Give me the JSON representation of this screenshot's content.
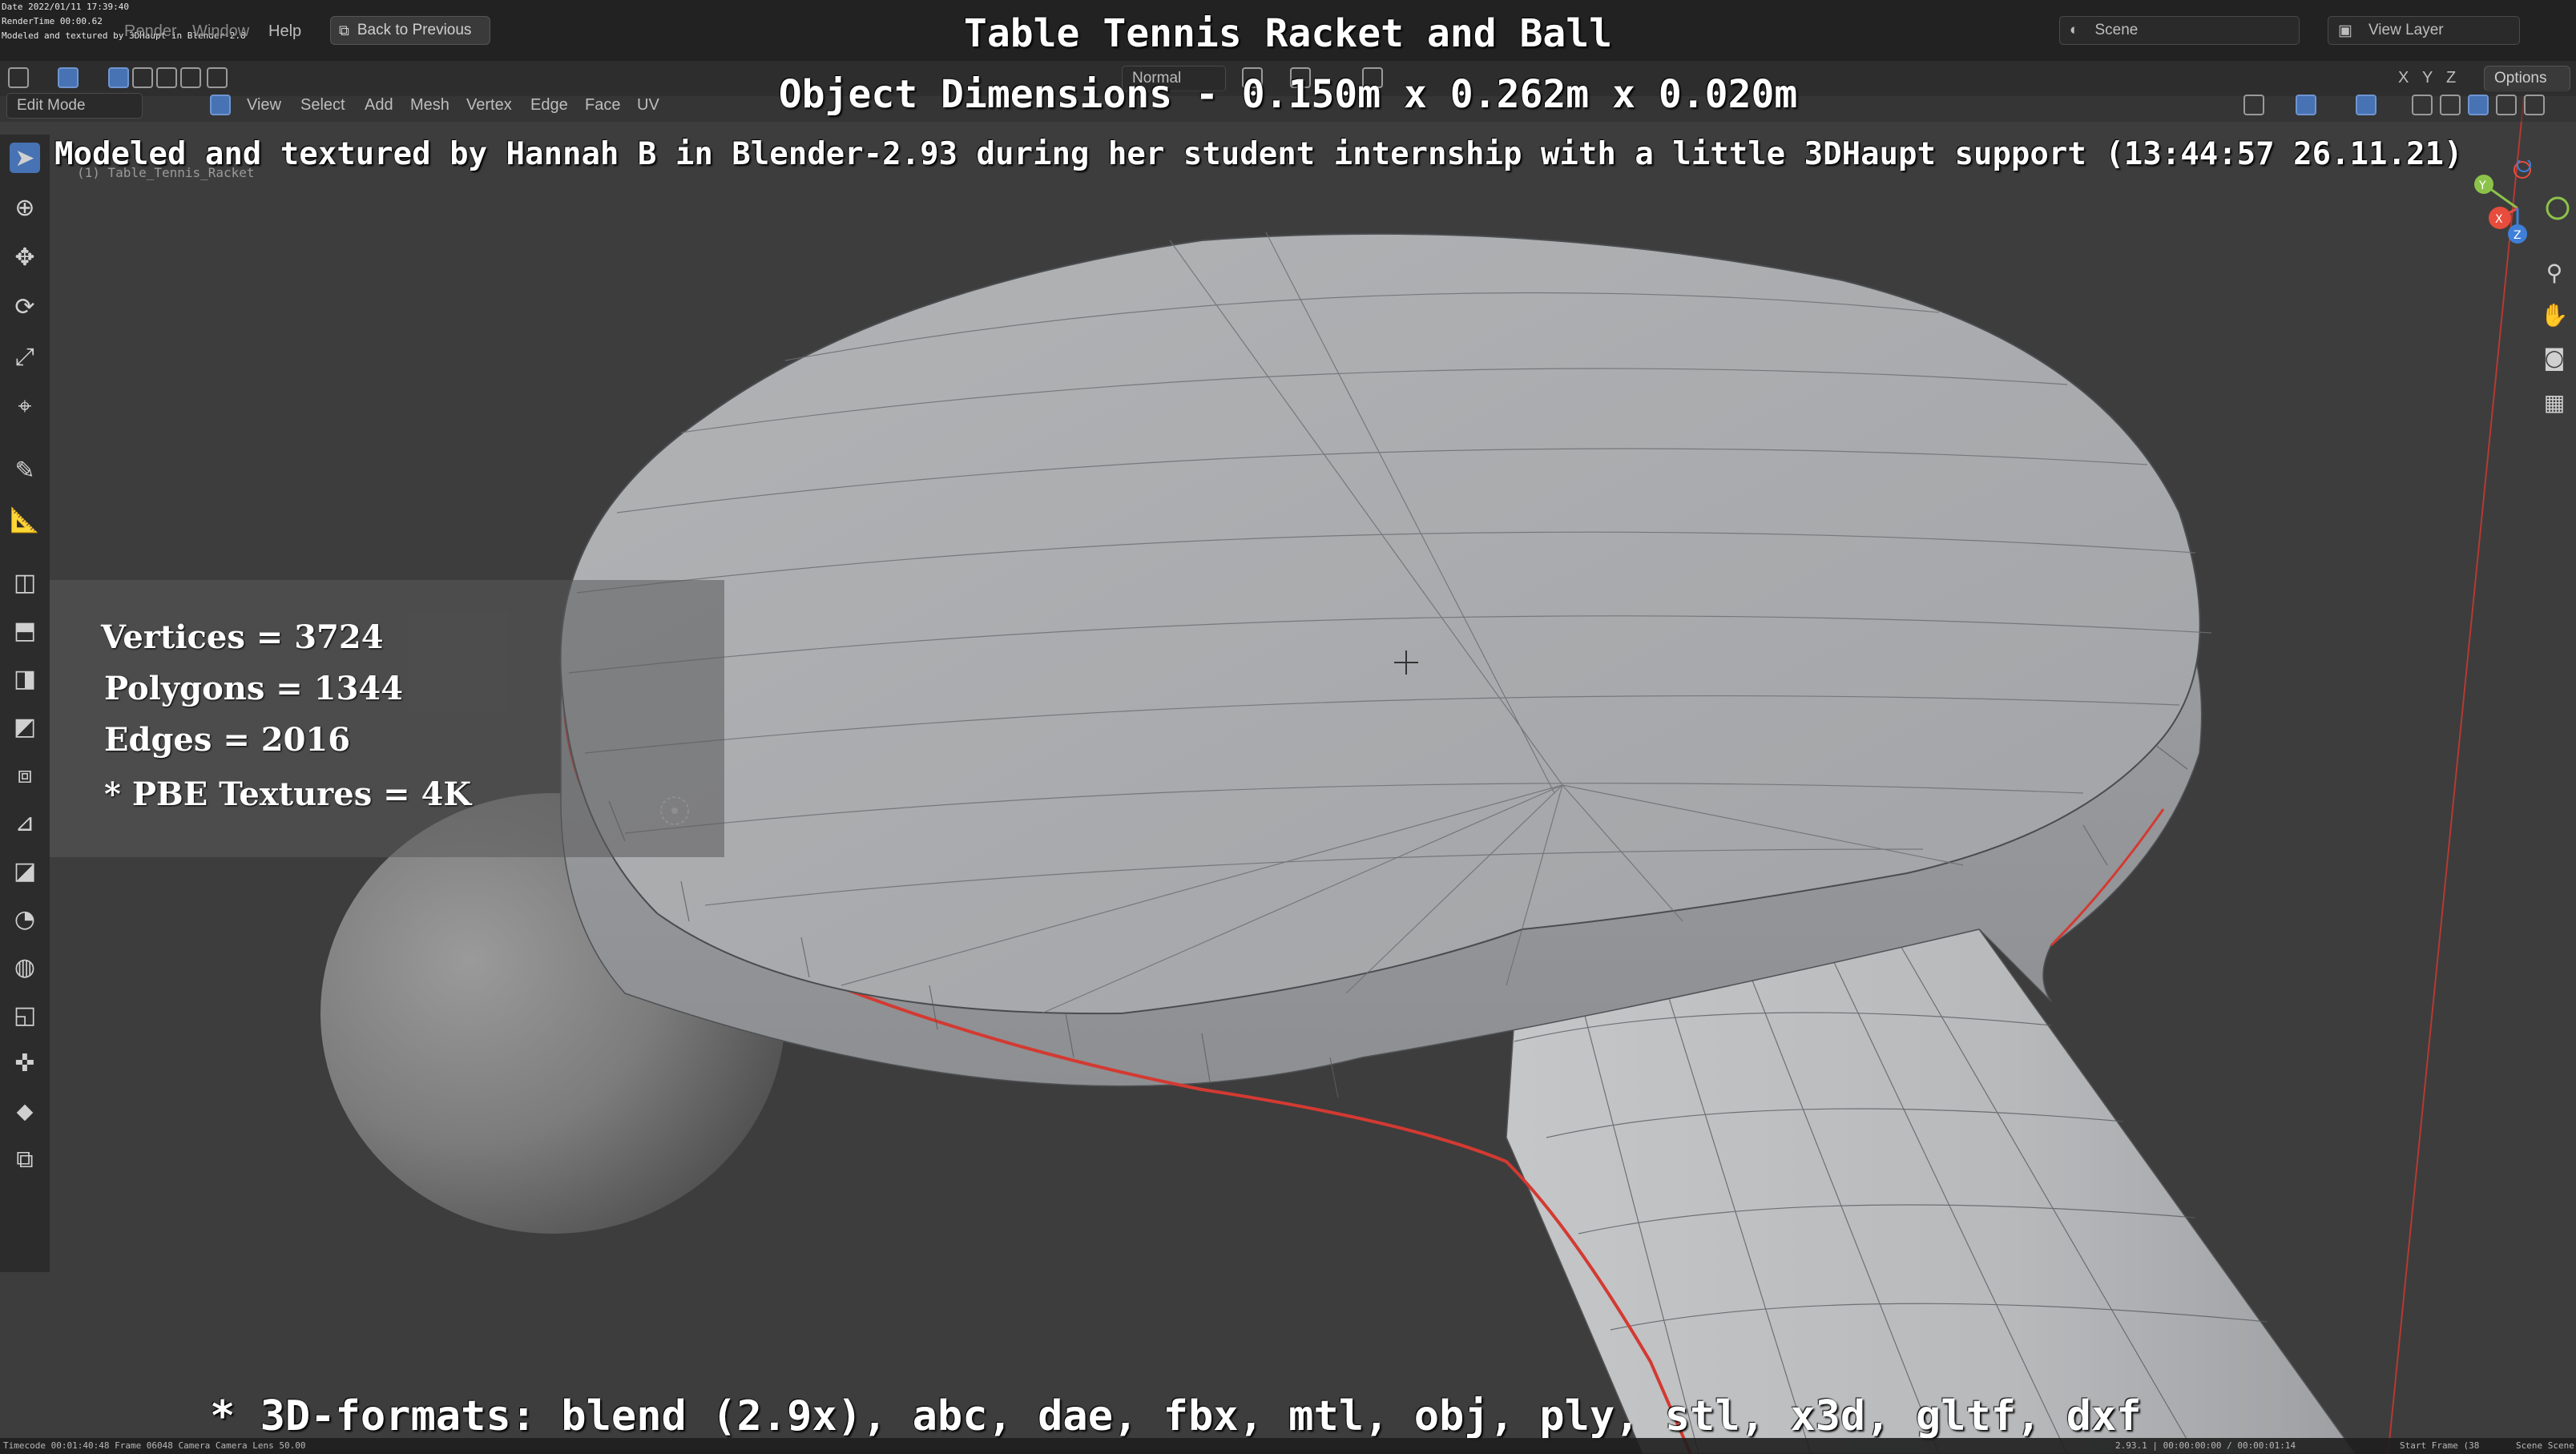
{
  "overlay": {
    "title": "Table Tennis Racket and Ball",
    "dimensions": "Object Dimensions -  0.150m x 0.262m x 0.020m",
    "credit": "Modeled and textured by Hannah B in Blender-2.93 during her student internship with a little 3DHaupt support (13:44:57 26.11.21)",
    "formats": "* 3D-formats: blend (2.9x), abc, dae, fbx, mtl, obj, ply, stl, x3d, gltf, dxf",
    "stats": {
      "vertices": "Vertices = 3724",
      "polygons": "Polygons = 1344",
      "edges": "Edges = 2016",
      "textures": "* PBE Textures = 4K"
    }
  },
  "stamp": {
    "date": "Date 2022/01/11 17:39:40",
    "rendertime": "RenderTime 00:00.62",
    "note": "Modeled and textured by 3DHaupt in Blender-2.8"
  },
  "topbar": {
    "menus": [
      "Render",
      "Window",
      "Help"
    ],
    "back_button": "Back to Previous",
    "scene_label": "Scene",
    "view_layer_label": "View Layer"
  },
  "header": {
    "mode": "Edit Mode",
    "menus": [
      "View",
      "Select",
      "Add",
      "Mesh",
      "Vertex",
      "Edge",
      "Face",
      "UV"
    ],
    "orientation": "Normal",
    "options": "Options",
    "axes": [
      "X",
      "Y",
      "Z"
    ]
  },
  "viewport_info": {
    "object_name": "(1) Table_Tennis_Racket"
  },
  "gizmo": {
    "x": "X",
    "y": "Y",
    "z": "Z"
  },
  "statusbar": {
    "left": "Timecode 00:01:40:48   Frame 06048   Camera Camera   Lens 50.00",
    "right_version": "2.93.1 | 00:00:00:00 / 00:00:01:14",
    "right_frame": "Start Frame (38",
    "right_scene": "Scene Scene"
  },
  "colors": {
    "background": "#3d3d3d",
    "racket": "#a7a9ab",
    "seam": "#d33a32",
    "active_tool": "#4772b3"
  },
  "icons": {
    "select": "cursor-arrow-icon",
    "cursor": "3d-cursor-icon",
    "move": "move-icon",
    "rotate": "rotate-icon",
    "scale": "scale-icon",
    "transform": "transform-icon",
    "annotate": "annotate-icon",
    "measure": "measure-icon"
  }
}
